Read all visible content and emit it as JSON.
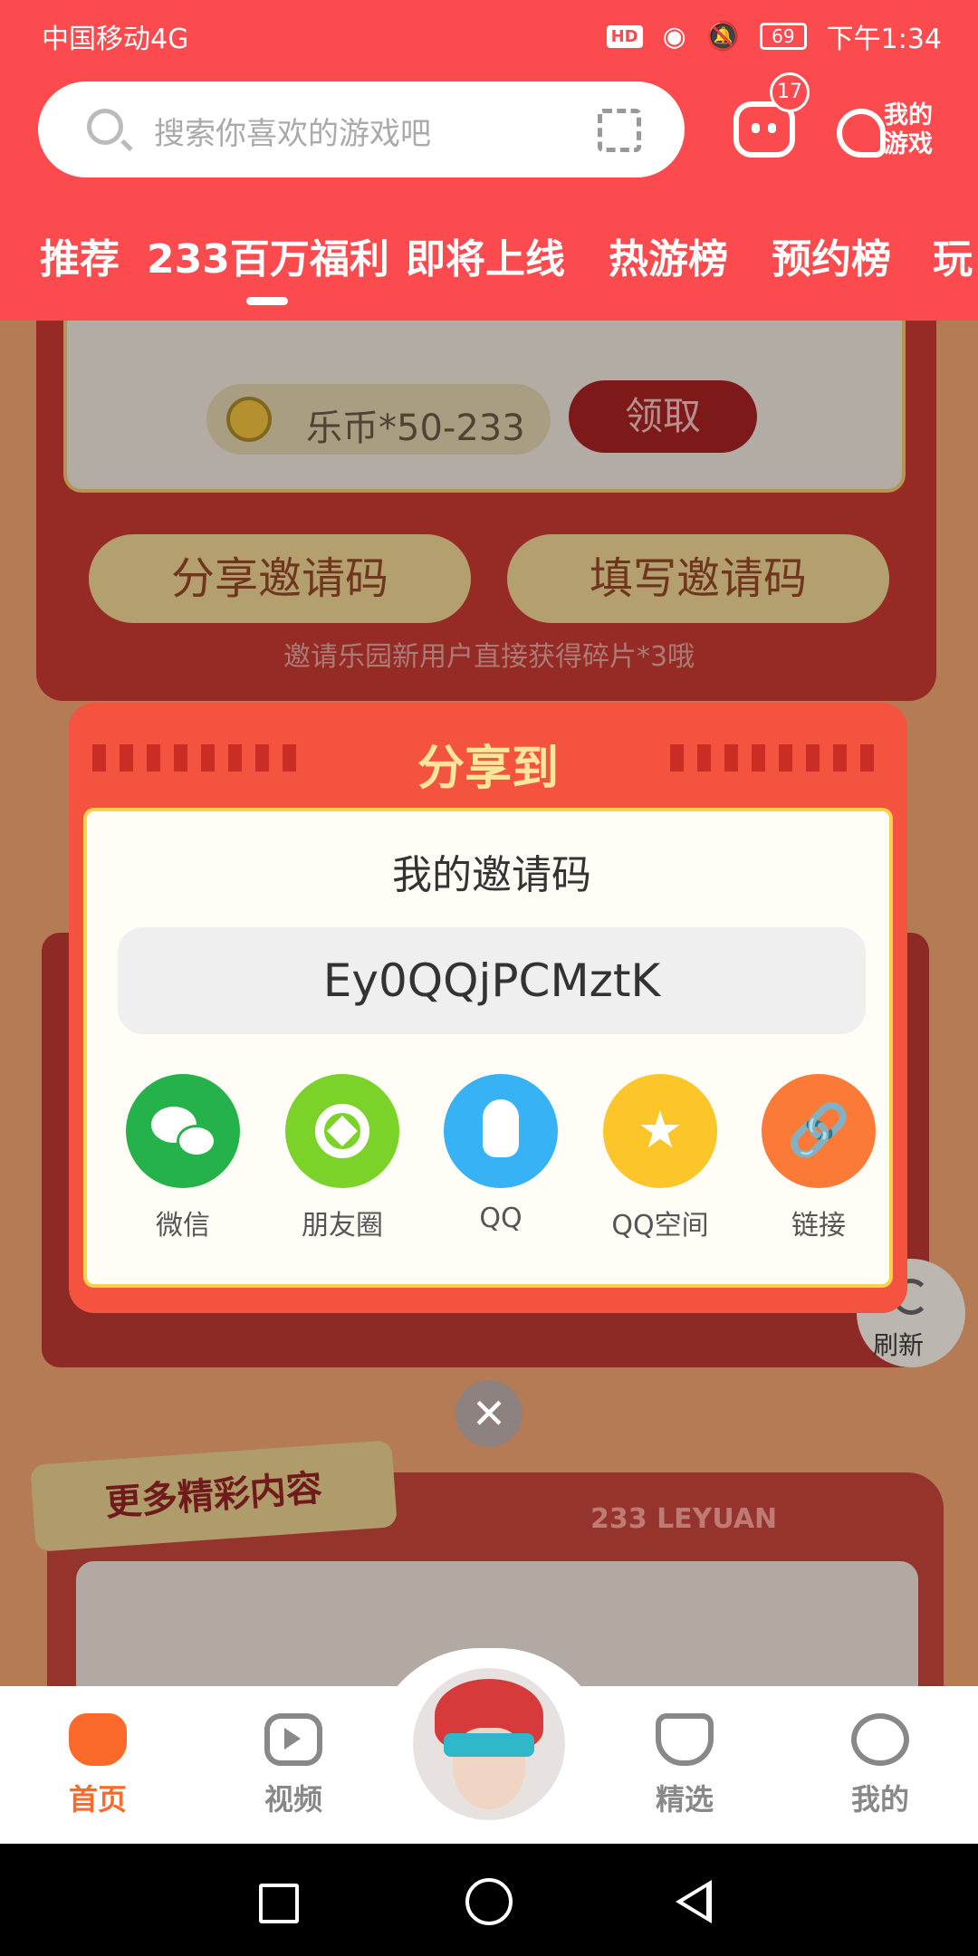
{
  "status_bar": {
    "carrier": "中国移动4G",
    "network": "4G",
    "battery": "69",
    "time": "下午1:34",
    "hd": "HD"
  },
  "header": {
    "search_placeholder": "搜索你喜欢的游戏吧",
    "message_badge": "17",
    "my_games": "我的游戏"
  },
  "tabs": [
    {
      "label": "推荐"
    },
    {
      "label": "233百万福利"
    },
    {
      "label": "即将上线"
    },
    {
      "label": "热游榜"
    },
    {
      "label": "预约榜"
    },
    {
      "label": "玩"
    }
  ],
  "background": {
    "coin_reward": "乐币*50-233",
    "claim": "领取",
    "share_code": "分享邀请码",
    "fill_code": "填写邀请码",
    "invite_hint": "邀请乐园新用户直接获得碎片*3哦",
    "refresh": "刷新",
    "more_content": "更多精彩内容",
    "leyuan": "233 LEYUAN"
  },
  "dialog": {
    "title": "分享到",
    "code_label": "我的邀请码",
    "invite_code": "Ey0QQjPCMztK",
    "targets": [
      {
        "label": "微信",
        "icon": "wechat-icon",
        "color": "#26b24a"
      },
      {
        "label": "朋友圈",
        "icon": "moments-icon",
        "color": "#7bd228"
      },
      {
        "label": "QQ",
        "icon": "qq-icon",
        "color": "#37b2f4"
      },
      {
        "label": "QQ空间",
        "icon": "qzone-icon",
        "color": "#fcc62a"
      },
      {
        "label": "链接",
        "icon": "link-icon",
        "color": "#fb7a38"
      }
    ],
    "close": "✕"
  },
  "bottom_nav": [
    {
      "label": "首页",
      "icon": "gamepad-icon",
      "active": true
    },
    {
      "label": "视频",
      "icon": "video-icon"
    },
    {
      "label": "精选",
      "icon": "heart-icon"
    },
    {
      "label": "我的",
      "icon": "profile-icon"
    }
  ],
  "colors": {
    "brand_red": "#fb4b4f",
    "active_orange": "#fb6a2a",
    "dialog_red": "#f4533f"
  }
}
